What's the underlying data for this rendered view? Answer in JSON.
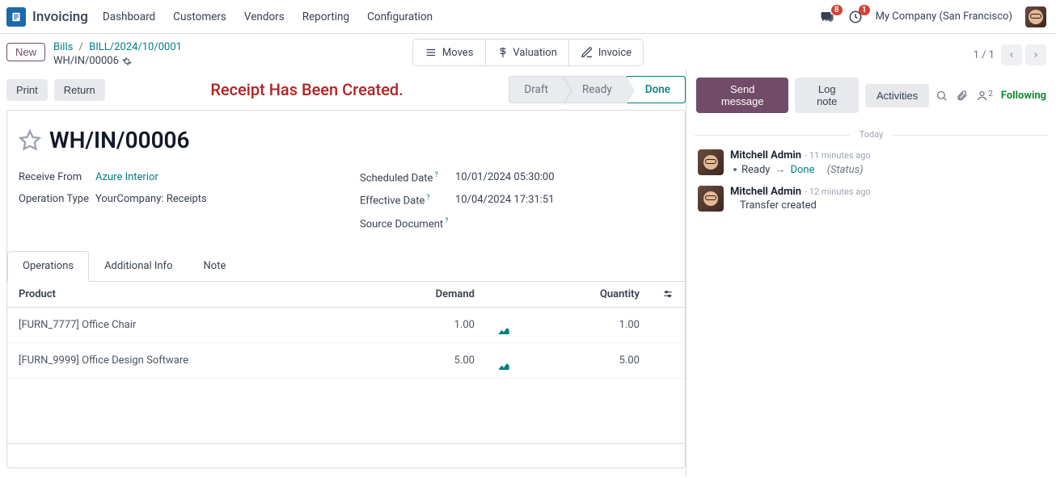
{
  "nav": {
    "app": "Invoicing",
    "items": [
      "Dashboard",
      "Customers",
      "Vendors",
      "Reporting",
      "Configuration"
    ],
    "chat_badge": "8",
    "clock_badge": "1",
    "company": "My Company (San Francisco)"
  },
  "breadcrumb": {
    "new": "New",
    "bills": "Bills",
    "bill_ref": "BILL/2024/10/0001",
    "current": "WH/IN/00006"
  },
  "top_actions": {
    "moves": "Moves",
    "valuation": "Valuation",
    "invoice": "Invoice"
  },
  "pager": {
    "text": "1 / 1"
  },
  "buttons": {
    "print": "Print",
    "return": "Return"
  },
  "alert": "Receipt Has Been Created.",
  "statusbar": {
    "draft": "Draft",
    "ready": "Ready",
    "done": "Done"
  },
  "doc": {
    "title": "WH/IN/00006",
    "receive_from_label": "Receive From",
    "receive_from": "Azure Interior",
    "optype_label": "Operation Type",
    "optype": "YourCompany: Receipts",
    "sched_label": "Scheduled Date",
    "sched": "10/01/2024 05:30:00",
    "eff_label": "Effective Date",
    "eff": "10/04/2024 17:31:51",
    "src_label": "Source Document"
  },
  "tabs": {
    "ops": "Operations",
    "addl": "Additional Info",
    "note": "Note"
  },
  "table": {
    "h_product": "Product",
    "h_demand": "Demand",
    "h_qty": "Quantity",
    "rows": [
      {
        "product": "[FURN_7777] Office Chair",
        "demand": "1.00",
        "qty": "1.00"
      },
      {
        "product": "[FURN_9999] Office Design Software",
        "demand": "5.00",
        "qty": "5.00"
      }
    ]
  },
  "chatter": {
    "send": "Send message",
    "log": "Log note",
    "act": "Activities",
    "follow": "Following",
    "follow_count": "2",
    "today": "Today",
    "messages": [
      {
        "author": "Mitchell Admin",
        "time": "- 11 minutes ago",
        "type": "status",
        "from": "Ready",
        "to": "Done",
        "suffix": "(Status)"
      },
      {
        "author": "Mitchell Admin",
        "time": "- 12 minutes ago",
        "type": "text",
        "body": "Transfer created"
      }
    ]
  }
}
